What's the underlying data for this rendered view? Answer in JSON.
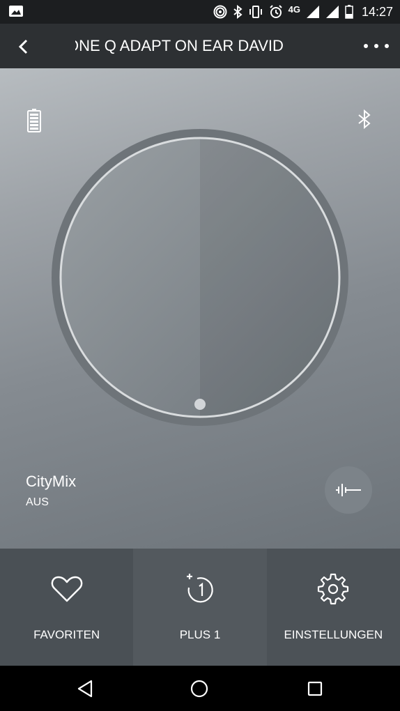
{
  "status_bar": {
    "network": "4G",
    "time": "14:27",
    "icons": [
      "image-icon",
      "hotspot-icon",
      "bluetooth-icon",
      "vibrate-icon",
      "alarm-icon",
      "signal-icon",
      "signal-icon",
      "battery-icon"
    ]
  },
  "header": {
    "title": "ONE Q ADAPT ON EAR DAVID",
    "back_icon": "chevron-left-icon",
    "menu_icon": "more-dots-icon"
  },
  "main": {
    "battery_icon": "battery-icon",
    "bluetooth_icon": "bluetooth-icon",
    "dial_value_fraction": 0.0,
    "citymix": {
      "name": "CityMix",
      "state": "AUS"
    },
    "eq_icon": "equalizer-icon"
  },
  "tabs": [
    {
      "label": "FAVORITEN",
      "icon": "heart-icon"
    },
    {
      "label": "PLUS 1",
      "icon": "plus-one-icon"
    },
    {
      "label": "EINSTELLUNGEN",
      "icon": "gear-icon"
    }
  ],
  "colors": {
    "header_bg": "#2d3033",
    "status_bg": "#1c1e20",
    "accent": "#ffffff"
  }
}
